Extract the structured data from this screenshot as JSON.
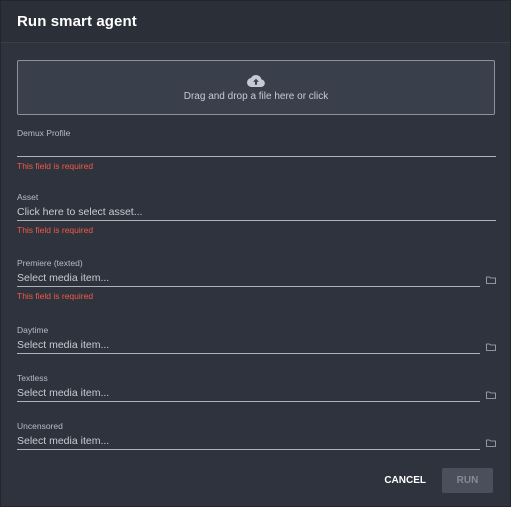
{
  "dialog": {
    "title": "Run smart agent"
  },
  "dropzone": {
    "text": "Drag and drop a file here or click",
    "icon": "cloud-upload-icon"
  },
  "fields": {
    "demux_profile": {
      "label": "Demux Profile",
      "value": "",
      "error": "This field is required"
    },
    "asset": {
      "label": "Asset",
      "placeholder": "Click here to select asset...",
      "error": "This field is required"
    },
    "premiere": {
      "label": "Premiere (texted)",
      "placeholder": "Select media item...",
      "error": "This field is required",
      "icon": "folder-icon"
    },
    "daytime": {
      "label": "Daytime",
      "placeholder": "Select media item...",
      "icon": "folder-icon"
    },
    "textless": {
      "label": "Textless",
      "placeholder": "Select media item...",
      "icon": "folder-icon"
    },
    "uncensored": {
      "label": "Uncensored",
      "placeholder": "Select media item...",
      "icon": "folder-icon"
    }
  },
  "actions": {
    "cancel_label": "CANCEL",
    "run_label": "RUN",
    "run_disabled": true
  },
  "colors": {
    "background": "#2f333d",
    "error": "#f15b47",
    "text": "#c9ccd2"
  }
}
